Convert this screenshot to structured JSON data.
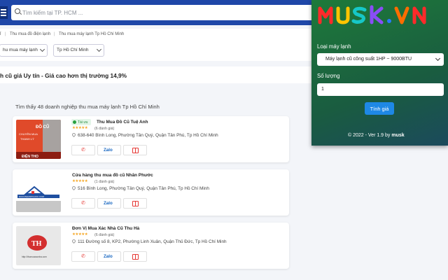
{
  "search": {
    "placeholder": "Tìm kiếm tại TP. HCM ..."
  },
  "breadcrumbs": [
    "ỉ",
    "Thu mua đồ điện lạnh",
    "Thu mua máy lạnh Tp Hồ Chí Minh"
  ],
  "filters": [
    "hu mua máy lạnh",
    "Tp Hồ Chí Minh"
  ],
  "banner": "h cũ giá Uy tín - Giá cao hơn thị trường 14,9%",
  "results_count": "Tìm thấy 48 doanh nghiệp thu mua máy lạnh Tp Hồ Chí Minh",
  "listings": [
    {
      "badge": "Tài ưu",
      "name": "Thu Mua Đồ Cũ Tuệ Anh",
      "stars": "★★★★★",
      "rating": "(6 đánh giá)",
      "address": "638-640 Bình Long, Phường Tân Quý, Quận Tân Phú, Tp Hồ Chí Minh",
      "zalo": "Zalo",
      "thumb_text": [
        "ĐỒ CŨ",
        "CHUYÊN MUA",
        "THANH LÝ",
        "ĐIỆN THO"
      ]
    },
    {
      "name": "Cửa hàng thu mua đồ cũ Nhân Phước",
      "stars": "★★★★★",
      "rating": "(1 đánh giá)",
      "address": "516 Bình Long, Phường Tân Quý, Quận Tân Phú, Tp Hồ Chí Minh",
      "zalo": "Zalo",
      "thumb_text": [
        "DOCUNHANPHUOC.COM"
      ]
    },
    {
      "name": "Đơn Vị Mua Xác Nhà Cũ Thu Hà",
      "stars": "★★★★★",
      "rating": "(6 đánh giá)",
      "address": "111 Đường số 8, KP2, Phường Linh Xuân, Quận Thủ Đức, Tp Hồ Chí Minh",
      "zalo": "Zalo",
      "thumb_text": [
        "TH",
        "http://thumuaxacnha.com"
      ]
    }
  ],
  "popup": {
    "logo": [
      "M",
      "U",
      "S",
      "K",
      ".",
      "V",
      "N"
    ],
    "type_label": "Loại máy lạnh",
    "type_value": "Máy lạnh cũ công suất 1HP ~ 9000BTU",
    "qty_label": "Số lượng",
    "qty_value": "1",
    "button": "Tính giá",
    "footer_prefix": "© 2022 - Ver 1.9 by",
    "footer_brand": "musk"
  },
  "colors": {
    "topbar": "#1f47a8",
    "popup": "#1d7a3a",
    "button": "#1e88e5",
    "call": "#e53935",
    "zalo": "#1565c0"
  }
}
